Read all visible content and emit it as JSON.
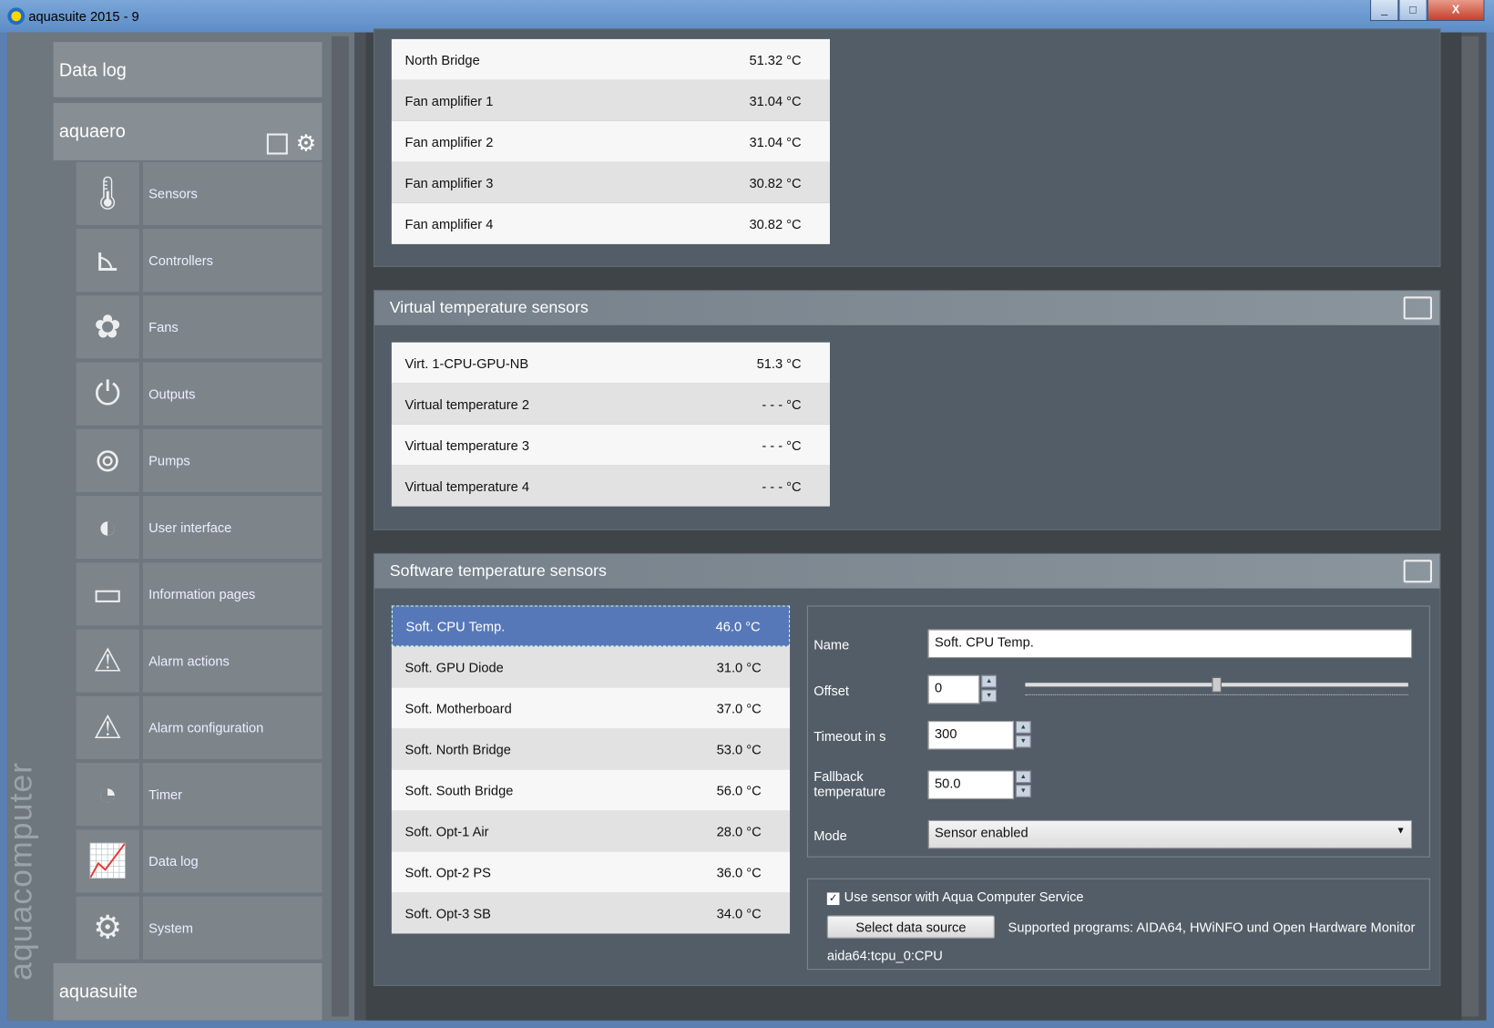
{
  "window": {
    "title": "aquasuite 2015 - 9",
    "minimize": "_",
    "maximize": "□",
    "close": "X"
  },
  "sidebar": {
    "brand": "aquacomputer",
    "data_log": "Data log",
    "device": "aquaero",
    "footer": "aquasuite",
    "items": [
      {
        "label": "Sensors",
        "icon": "thermometer-icon"
      },
      {
        "label": "Controllers",
        "icon": "controller-icon"
      },
      {
        "label": "Fans",
        "icon": "fan-icon"
      },
      {
        "label": "Outputs",
        "icon": "plug-icon"
      },
      {
        "label": "Pumps",
        "icon": "pump-icon"
      },
      {
        "label": "User interface",
        "icon": "brightness-icon"
      },
      {
        "label": "Information pages",
        "icon": "pages-icon"
      },
      {
        "label": "Alarm actions",
        "icon": "alarm-icon"
      },
      {
        "label": "Alarm configuration",
        "icon": "alarm-config-icon"
      },
      {
        "label": "Timer",
        "icon": "timer-icon"
      },
      {
        "label": "Data log",
        "icon": "chart-icon"
      },
      {
        "label": "System",
        "icon": "gear-icon"
      }
    ]
  },
  "temp_sensors": [
    {
      "name": "North Bridge",
      "value": "51.32 °C"
    },
    {
      "name": "Fan amplifier 1",
      "value": "31.04 °C"
    },
    {
      "name": "Fan amplifier 2",
      "value": "31.04 °C"
    },
    {
      "name": "Fan amplifier 3",
      "value": "30.82 °C"
    },
    {
      "name": "Fan amplifier 4",
      "value": "30.82 °C"
    }
  ],
  "virtual": {
    "title": "Virtual temperature sensors",
    "rows": [
      {
        "name": "Virt. 1-CPU-GPU-NB",
        "value": "51.3 °C"
      },
      {
        "name": "Virtual temperature 2",
        "value": "- - - °C"
      },
      {
        "name": "Virtual temperature 3",
        "value": "- - - °C"
      },
      {
        "name": "Virtual temperature 4",
        "value": "- - - °C"
      }
    ]
  },
  "software": {
    "title": "Software temperature sensors",
    "rows": [
      {
        "name": "Soft. CPU Temp.",
        "value": "46.0 °C"
      },
      {
        "name": "Soft. GPU Diode",
        "value": "31.0 °C"
      },
      {
        "name": "Soft. Motherboard",
        "value": "37.0 °C"
      },
      {
        "name": "Soft. North Bridge",
        "value": "53.0 °C"
      },
      {
        "name": "Soft. South Bridge",
        "value": "56.0 °C"
      },
      {
        "name": "Soft. Opt-1 Air",
        "value": "28.0 °C"
      },
      {
        "name": "Soft. Opt-2 PS",
        "value": "36.0 °C"
      },
      {
        "name": "Soft. Opt-3 SB",
        "value": "34.0 °C"
      }
    ],
    "form": {
      "name_label": "Name",
      "name_value": "Soft. CPU Temp.",
      "offset_label": "Offset",
      "offset_value": "0",
      "offset_slider": 0.5,
      "timeout_label": "Timeout in s",
      "timeout_value": "300",
      "fallback_label": "Fallback temperature",
      "fallback_value": "50.0",
      "mode_label": "Mode",
      "mode_value": "Sensor enabled"
    },
    "service_label": "Use sensor with Aqua Computer Service",
    "service_checked": true,
    "select_button": "Select data source",
    "supported": "Supported programs: AIDA64, HWiNFO und Open Hardware Monitor",
    "source": "aida64:tcpu_0:CPU"
  }
}
